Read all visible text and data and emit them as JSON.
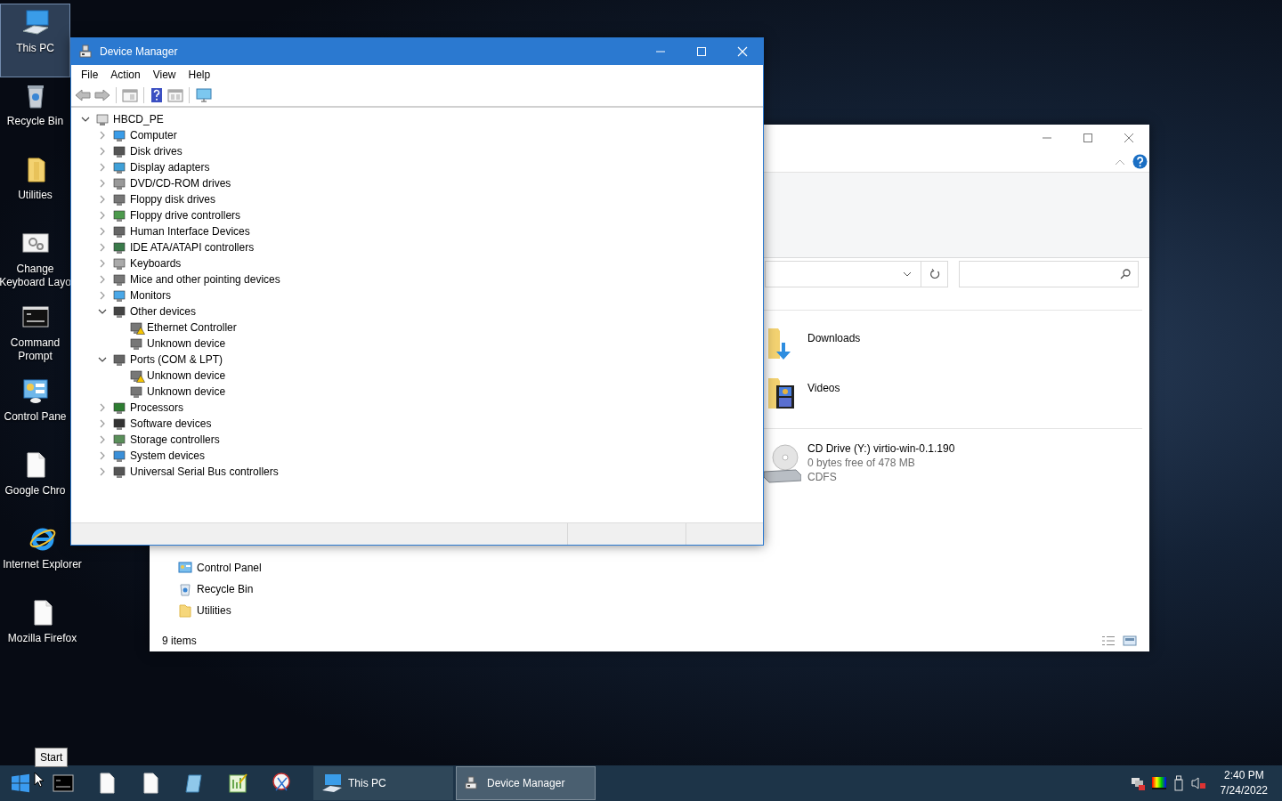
{
  "desktop_icons": [
    {
      "label": "This PC",
      "kind": "pc",
      "selected": true
    },
    {
      "label": "Recycle Bin",
      "kind": "bin",
      "selected": false
    },
    {
      "label": "Utilities",
      "kind": "folder",
      "selected": false
    },
    {
      "label": "Change\nKeyboard Layo",
      "kind": "settings",
      "selected": false
    },
    {
      "label": "Command\nPrompt",
      "kind": "cmd",
      "selected": false
    },
    {
      "label": "Control Pane",
      "kind": "control",
      "selected": false
    },
    {
      "label": "Google Chro",
      "kind": "file",
      "selected": false
    },
    {
      "label": "Internet Explorer",
      "kind": "ie",
      "selected": false
    },
    {
      "label": "Mozilla Firefox",
      "kind": "file",
      "selected": false
    }
  ],
  "explorer": {
    "items": [
      {
        "name": "Downloads",
        "kind": "downloads"
      },
      {
        "name": "Videos",
        "kind": "videos"
      }
    ],
    "drives": [
      {
        "name": "CD Drive (Y:) virtio-win-0.1.190",
        "space": "0 bytes free of 478 MB",
        "filesystem": "CDFS"
      }
    ],
    "nav_items": [
      {
        "label": "Control Panel",
        "kind": "control"
      },
      {
        "label": "Recycle Bin",
        "kind": "bin"
      },
      {
        "label": "Utilities",
        "kind": "folder"
      }
    ],
    "status": "9 items"
  },
  "device_manager": {
    "title": "Device Manager",
    "menu": [
      "File",
      "Action",
      "View",
      "Help"
    ],
    "tree": {
      "label": "HBCD_PE",
      "expanded": true,
      "children": [
        {
          "label": "Computer",
          "expanded": false
        },
        {
          "label": "Disk drives",
          "expanded": false
        },
        {
          "label": "Display adapters",
          "expanded": false
        },
        {
          "label": "DVD/CD-ROM drives",
          "expanded": false
        },
        {
          "label": "Floppy disk drives",
          "expanded": false
        },
        {
          "label": "Floppy drive controllers",
          "expanded": false
        },
        {
          "label": "Human Interface Devices",
          "expanded": false
        },
        {
          "label": "IDE ATA/ATAPI controllers",
          "expanded": false
        },
        {
          "label": "Keyboards",
          "expanded": false
        },
        {
          "label": "Mice and other pointing devices",
          "expanded": false
        },
        {
          "label": "Monitors",
          "expanded": false
        },
        {
          "label": "Other devices",
          "expanded": true,
          "children": [
            {
              "label": "Ethernet Controller",
              "warning": true
            },
            {
              "label": "Unknown device",
              "warning": false
            }
          ]
        },
        {
          "label": "Ports (COM & LPT)",
          "expanded": true,
          "children": [
            {
              "label": "Unknown device",
              "warning": true
            },
            {
              "label": "Unknown device",
              "warning": false
            }
          ]
        },
        {
          "label": "Processors",
          "expanded": false
        },
        {
          "label": "Software devices",
          "expanded": false
        },
        {
          "label": "Storage controllers",
          "expanded": false
        },
        {
          "label": "System devices",
          "expanded": false
        },
        {
          "label": "Universal Serial Bus controllers",
          "expanded": false
        }
      ]
    }
  },
  "taskbar": {
    "start_tooltip": "Start",
    "windows": [
      {
        "title": "This PC",
        "kind": "pc",
        "selected": false
      },
      {
        "title": "Device Manager",
        "kind": "devmgr",
        "selected": true
      }
    ],
    "clock": {
      "time": "2:40 PM",
      "date": "7/24/2022"
    }
  }
}
